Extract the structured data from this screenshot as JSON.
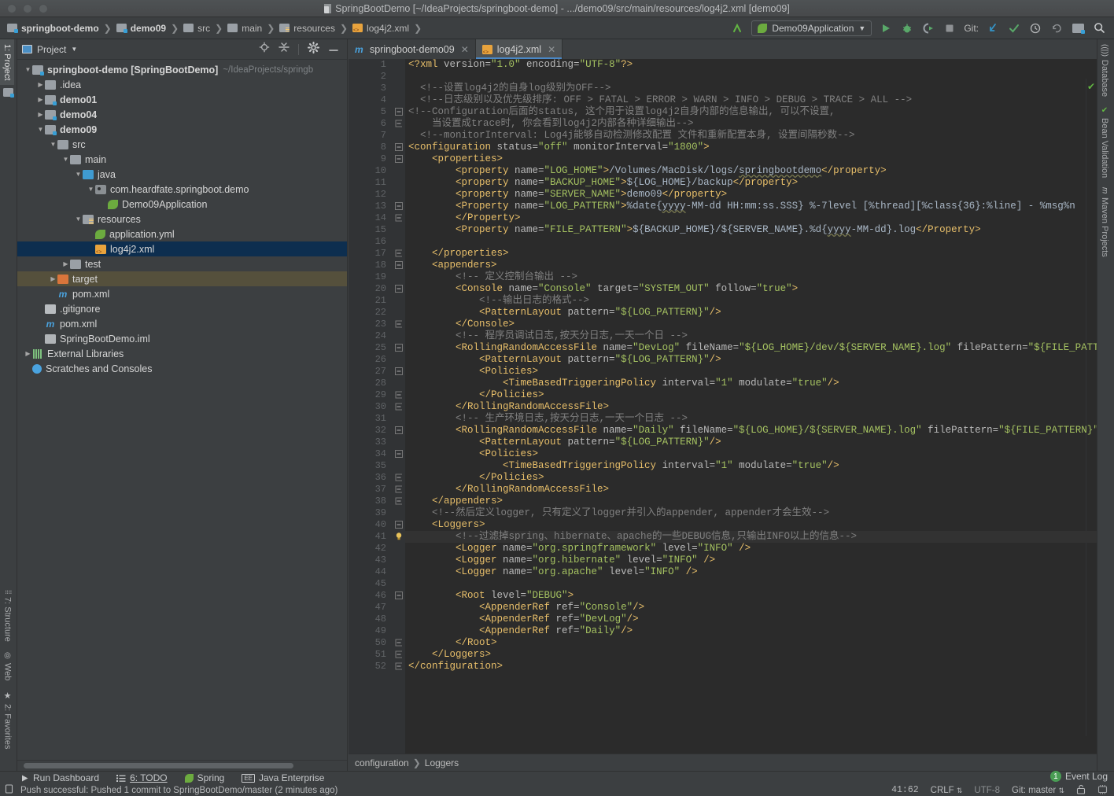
{
  "window": {
    "title": "SpringBootDemo [~/IdeaProjects/springboot-demo] - .../demo09/src/main/resources/log4j2.xml [demo09]"
  },
  "toolbar": {
    "breadcrumbs": [
      {
        "label": "springboot-demo",
        "icon": "module-folder-icon",
        "bold": true
      },
      {
        "label": "demo09",
        "icon": "module-folder-icon",
        "bold": true
      },
      {
        "label": "src",
        "icon": "folder-icon",
        "bold": false
      },
      {
        "label": "main",
        "icon": "folder-icon",
        "bold": false
      },
      {
        "label": "resources",
        "icon": "resources-folder-icon",
        "bold": false
      },
      {
        "label": "log4j2.xml",
        "icon": "xml-file-icon",
        "bold": false
      }
    ],
    "run_config": "Demo09Application",
    "git_label": "Git:"
  },
  "project_panel": {
    "title": "Project",
    "tree": [
      {
        "depth": 0,
        "arrow": "▼",
        "icon": "module-folder-icon",
        "name": "springboot-demo [SpringBootDemo]",
        "bold": true,
        "path": "~/IdeaProjects/springb",
        "state": "normal"
      },
      {
        "depth": 1,
        "arrow": "▶",
        "icon": "folder-icon",
        "name": ".idea",
        "bold": false,
        "path": "",
        "state": "normal"
      },
      {
        "depth": 1,
        "arrow": "▶",
        "icon": "module-folder-icon",
        "name": "demo01",
        "bold": true,
        "path": "",
        "state": "normal"
      },
      {
        "depth": 1,
        "arrow": "▶",
        "icon": "module-folder-icon",
        "name": "demo04",
        "bold": true,
        "path": "",
        "state": "normal"
      },
      {
        "depth": 1,
        "arrow": "▼",
        "icon": "module-folder-icon",
        "name": "demo09",
        "bold": true,
        "path": "",
        "state": "normal"
      },
      {
        "depth": 2,
        "arrow": "▼",
        "icon": "folder-icon",
        "name": "src",
        "bold": false,
        "path": "",
        "state": "normal"
      },
      {
        "depth": 3,
        "arrow": "▼",
        "icon": "folder-icon",
        "name": "main",
        "bold": false,
        "path": "",
        "state": "normal"
      },
      {
        "depth": 4,
        "arrow": "▼",
        "icon": "source-folder-icon",
        "name": "java",
        "bold": false,
        "path": "",
        "state": "normal"
      },
      {
        "depth": 5,
        "arrow": "▼",
        "icon": "package-icon",
        "name": "com.heardfate.springboot.demo",
        "bold": false,
        "path": "",
        "state": "normal"
      },
      {
        "depth": 6,
        "arrow": "",
        "icon": "spring-class-icon",
        "name": "Demo09Application",
        "bold": false,
        "path": "",
        "state": "normal"
      },
      {
        "depth": 4,
        "arrow": "▼",
        "icon": "resources-folder-icon",
        "name": "resources",
        "bold": false,
        "path": "",
        "state": "normal"
      },
      {
        "depth": 5,
        "arrow": "",
        "icon": "spring-yml-icon",
        "name": "application.yml",
        "bold": false,
        "path": "",
        "state": "normal"
      },
      {
        "depth": 5,
        "arrow": "",
        "icon": "xml-file-icon",
        "name": "log4j2.xml",
        "bold": false,
        "path": "",
        "state": "selected"
      },
      {
        "depth": 3,
        "arrow": "▶",
        "icon": "folder-icon",
        "name": "test",
        "bold": false,
        "path": "",
        "state": "normal"
      },
      {
        "depth": 2,
        "arrow": "▶",
        "icon": "excluded-folder-icon",
        "name": "target",
        "bold": false,
        "path": "",
        "state": "highlight"
      },
      {
        "depth": 2,
        "arrow": "",
        "icon": "maven-icon",
        "name": "pom.xml",
        "bold": false,
        "path": "",
        "state": "normal"
      },
      {
        "depth": 1,
        "arrow": "",
        "icon": "file-icon",
        "name": ".gitignore",
        "bold": false,
        "path": "",
        "state": "normal"
      },
      {
        "depth": 1,
        "arrow": "",
        "icon": "maven-icon",
        "name": "pom.xml",
        "bold": false,
        "path": "",
        "state": "normal"
      },
      {
        "depth": 1,
        "arrow": "",
        "icon": "iml-file-icon",
        "name": "SpringBootDemo.iml",
        "bold": false,
        "path": "",
        "state": "normal"
      },
      {
        "depth": 0,
        "arrow": "▶",
        "icon": "library-icon",
        "name": "External Libraries",
        "bold": false,
        "path": "",
        "state": "normal"
      },
      {
        "depth": 0,
        "arrow": "",
        "icon": "scratch-icon",
        "name": "Scratches and Consoles",
        "bold": false,
        "path": "",
        "state": "normal"
      }
    ]
  },
  "stripes": {
    "left_top": [
      "1: Project"
    ],
    "left_bottom": [
      "2: Favorites",
      "Web",
      "7: Structure"
    ],
    "right_top": [
      "Database",
      "Bean Validation",
      "Maven Projects"
    ]
  },
  "editor": {
    "tabs": [
      {
        "label": "springboot-demo09",
        "icon": "maven-icon",
        "active": false
      },
      {
        "label": "log4j2.xml",
        "icon": "xml-file-icon",
        "active": true
      }
    ],
    "current_line": 41,
    "breadcrumbs": [
      "configuration",
      "Loggers"
    ],
    "lines": [
      {
        "n": 1,
        "fold": "",
        "html": "<span class=\"pi\">&lt;?xml </span><span class=\"attr\">version=</span><span class=\"val\">\"1.0\"</span><span class=\"attr\"> encoding=</span><span class=\"val\">\"UTF-8\"</span><span class=\"pi\">?&gt;</span>"
      },
      {
        "n": 2,
        "fold": "",
        "html": ""
      },
      {
        "n": 3,
        "fold": "",
        "html": "  <span class=\"cmt\">&lt;!--设置log4j2的自身log级别为OFF--&gt;</span>"
      },
      {
        "n": 4,
        "fold": "",
        "html": "  <span class=\"cmt\">&lt;!--日志级别以及优先级排序: OFF &gt; FATAL &gt; ERROR &gt; WARN &gt; INFO &gt; DEBUG &gt; TRACE &gt; ALL --&gt;</span>"
      },
      {
        "n": 5,
        "fold": "-",
        "html": "<span class=\"cmt\">&lt;!--Configuration后面的status, 这个用于设置log4j2自身内部的信息输出, 可以不设置,</span>"
      },
      {
        "n": 6,
        "fold": "e",
        "html": "    <span class=\"cmt\">当设置成trace时, 你会看到log4j2内部各种详细输出--&gt;</span>"
      },
      {
        "n": 7,
        "fold": "",
        "html": "  <span class=\"cmt\">&lt;!--monitorInterval: Log4j能够自动检测修改配置 文件和重新配置本身, 设置间隔秒数--&gt;</span>"
      },
      {
        "n": 8,
        "fold": "-",
        "html": "<span class=\"tag\">&lt;configuration </span><span class=\"attr\">status=</span><span class=\"val\">\"off\"</span><span class=\"attr\"> monitorInterval=</span><span class=\"val\">\"1800\"</span><span class=\"tag\">&gt;</span>"
      },
      {
        "n": 9,
        "fold": "-",
        "html": "    <span class=\"tag\">&lt;properties&gt;</span>"
      },
      {
        "n": 10,
        "fold": "",
        "html": "        <span class=\"tag\">&lt;property </span><span class=\"attr\">name=</span><span class=\"val\">\"LOG_HOME\"</span><span class=\"tag\">&gt;</span><span class=\"txt\">/Volumes/MacDisk/logs/</span><span class=\"txt err-underline\">springbootdemo</span><span class=\"tag\">&lt;/property&gt;</span>"
      },
      {
        "n": 11,
        "fold": "",
        "html": "        <span class=\"tag\">&lt;property </span><span class=\"attr\">name=</span><span class=\"val\">\"BACKUP_HOME\"</span><span class=\"tag\">&gt;</span><span class=\"txt\">${LOG_HOME}/backup</span><span class=\"tag\">&lt;/property&gt;</span>"
      },
      {
        "n": 12,
        "fold": "",
        "html": "        <span class=\"tag\">&lt;property </span><span class=\"attr\">name=</span><span class=\"val\">\"SERVER_NAME\"</span><span class=\"tag\">&gt;</span><span class=\"txt\">demo09</span><span class=\"tag\">&lt;/property&gt;</span>"
      },
      {
        "n": 13,
        "fold": "-",
        "html": "        <span class=\"tag\">&lt;Property </span><span class=\"attr\">name=</span><span class=\"val\">\"LOG_PATTERN\"</span><span class=\"tag\">&gt;</span><span class=\"txt\">%date{</span><span class=\"txt err-underline\">yyyy</span><span class=\"txt\">-MM-dd HH:mm:ss.SSS} %-7level [%thread][%class{36}:%line] - %msg%n</span>"
      },
      {
        "n": 14,
        "fold": "e",
        "html": "        <span class=\"tag\">&lt;/Property&gt;</span>"
      },
      {
        "n": 15,
        "fold": "",
        "html": "        <span class=\"tag\">&lt;Property </span><span class=\"attr\">name=</span><span class=\"val\">\"FILE_PATTERN\"</span><span class=\"tag\">&gt;</span><span class=\"txt\">${BACKUP_HOME}/${SERVER_NAME}.%d{</span><span class=\"txt err-underline\">yyyy</span><span class=\"txt\">-MM-dd}.log</span><span class=\"tag\">&lt;/Property&gt;</span>"
      },
      {
        "n": 16,
        "fold": "",
        "html": ""
      },
      {
        "n": 17,
        "fold": "e",
        "html": "    <span class=\"tag\">&lt;/properties&gt;</span>"
      },
      {
        "n": 18,
        "fold": "-",
        "html": "    <span class=\"tag\">&lt;appenders&gt;</span>"
      },
      {
        "n": 19,
        "fold": "",
        "html": "        <span class=\"cmt\">&lt;!-- 定义控制台输出 --&gt;</span>"
      },
      {
        "n": 20,
        "fold": "-",
        "html": "        <span class=\"tag\">&lt;Console </span><span class=\"attr\">name=</span><span class=\"val\">\"Console\"</span><span class=\"attr\"> target=</span><span class=\"val\">\"SYSTEM_OUT\"</span><span class=\"attr\"> follow=</span><span class=\"val\">\"true\"</span><span class=\"tag\">&gt;</span>"
      },
      {
        "n": 21,
        "fold": "",
        "html": "            <span class=\"cmt\">&lt;!--输出日志的格式--&gt;</span>"
      },
      {
        "n": 22,
        "fold": "",
        "html": "            <span class=\"tag\">&lt;PatternLayout </span><span class=\"attr\">pattern=</span><span class=\"val\">\"${LOG_PATTERN}\"</span><span class=\"tag\">/&gt;</span>"
      },
      {
        "n": 23,
        "fold": "e",
        "html": "        <span class=\"tag\">&lt;/Console&gt;</span>"
      },
      {
        "n": 24,
        "fold": "",
        "html": "        <span class=\"cmt\">&lt;!-- 程序员调试日志,按天分日志,一天一个日 --&gt;</span>"
      },
      {
        "n": 25,
        "fold": "-",
        "html": "        <span class=\"tag\">&lt;RollingRandomAccessFile </span><span class=\"attr\">name=</span><span class=\"val\">\"DevLog\"</span><span class=\"attr\"> fileName=</span><span class=\"val\">\"${LOG_HOME}/dev/${SERVER_NAME}.log\"</span><span class=\"attr\"> filePattern=</span><span class=\"val\">\"${FILE_PATTERN}\"</span><span class=\"tag\">&gt;</span>"
      },
      {
        "n": 26,
        "fold": "",
        "html": "            <span class=\"tag\">&lt;PatternLayout </span><span class=\"attr\">pattern=</span><span class=\"val\">\"${LOG_PATTERN}\"</span><span class=\"tag\">/&gt;</span>"
      },
      {
        "n": 27,
        "fold": "-",
        "html": "            <span class=\"tag\">&lt;Policies&gt;</span>"
      },
      {
        "n": 28,
        "fold": "",
        "html": "                <span class=\"tag\">&lt;TimeBasedTriggeringPolicy </span><span class=\"attr\">interval=</span><span class=\"val\">\"1\"</span><span class=\"attr\"> modulate=</span><span class=\"val\">\"true\"</span><span class=\"tag\">/&gt;</span>"
      },
      {
        "n": 29,
        "fold": "e",
        "html": "            <span class=\"tag\">&lt;/Policies&gt;</span>"
      },
      {
        "n": 30,
        "fold": "e",
        "html": "        <span class=\"tag\">&lt;/RollingRandomAccessFile&gt;</span>"
      },
      {
        "n": 31,
        "fold": "",
        "html": "        <span class=\"cmt\">&lt;!-- 生产环境日志,按天分日志,一天一个日志 --&gt;</span>"
      },
      {
        "n": 32,
        "fold": "-",
        "html": "        <span class=\"tag\">&lt;RollingRandomAccessFile </span><span class=\"attr\">name=</span><span class=\"val\">\"Daily\"</span><span class=\"attr\"> fileName=</span><span class=\"val\">\"${LOG_HOME}/${SERVER_NAME}.log\"</span><span class=\"attr\"> filePattern=</span><span class=\"val\">\"${FILE_PATTERN}\"</span><span class=\"tag\">&gt;</span>"
      },
      {
        "n": 33,
        "fold": "",
        "html": "            <span class=\"tag\">&lt;PatternLayout </span><span class=\"attr\">pattern=</span><span class=\"val\">\"${LOG_PATTERN}\"</span><span class=\"tag\">/&gt;</span>"
      },
      {
        "n": 34,
        "fold": "-",
        "html": "            <span class=\"tag\">&lt;Policies&gt;</span>"
      },
      {
        "n": 35,
        "fold": "",
        "html": "                <span class=\"tag\">&lt;TimeBasedTriggeringPolicy </span><span class=\"attr\">interval=</span><span class=\"val\">\"1\"</span><span class=\"attr\"> modulate=</span><span class=\"val\">\"true\"</span><span class=\"tag\">/&gt;</span>"
      },
      {
        "n": 36,
        "fold": "e",
        "html": "            <span class=\"tag\">&lt;/Policies&gt;</span>"
      },
      {
        "n": 37,
        "fold": "e",
        "html": "        <span class=\"tag\">&lt;/RollingRandomAccessFile&gt;</span>"
      },
      {
        "n": 38,
        "fold": "e",
        "html": "    <span class=\"tag\">&lt;/appenders&gt;</span>"
      },
      {
        "n": 39,
        "fold": "",
        "html": "    <span class=\"cmt\">&lt;!--然后定义logger, 只有定义了logger并引入的appender, appender才会生效--&gt;</span>"
      },
      {
        "n": 40,
        "fold": "-",
        "html": "    <span class=\"tag\">&lt;Loggers&gt;</span>"
      },
      {
        "n": 41,
        "fold": "",
        "html": "        <span class=\"cmt\">&lt;!--过滤掉spring、hibernate、apache的一些DEBUG信息,只输出INFO以上的信息--&gt;</span>"
      },
      {
        "n": 42,
        "fold": "",
        "html": "        <span class=\"tag\">&lt;Logger </span><span class=\"attr\">name=</span><span class=\"val\">\"org.springframework\"</span><span class=\"attr\"> level=</span><span class=\"val\">\"INFO\"</span><span class=\"tag\"> /&gt;</span>"
      },
      {
        "n": 43,
        "fold": "",
        "html": "        <span class=\"tag\">&lt;Logger </span><span class=\"attr\">name=</span><span class=\"val\">\"org.hibernate\"</span><span class=\"attr\"> level=</span><span class=\"val\">\"INFO\"</span><span class=\"tag\"> /&gt;</span>"
      },
      {
        "n": 44,
        "fold": "",
        "html": "        <span class=\"tag\">&lt;Logger </span><span class=\"attr\">name=</span><span class=\"val\">\"org.apache\"</span><span class=\"attr\"> level=</span><span class=\"val\">\"INFO\"</span><span class=\"tag\"> /&gt;</span>"
      },
      {
        "n": 45,
        "fold": "",
        "html": ""
      },
      {
        "n": 46,
        "fold": "-",
        "html": "        <span class=\"tag\">&lt;Root </span><span class=\"attr\">level=</span><span class=\"val\">\"DEBUG\"</span><span class=\"tag\">&gt;</span>"
      },
      {
        "n": 47,
        "fold": "",
        "html": "            <span class=\"tag\">&lt;AppenderRef </span><span class=\"attr\">ref=</span><span class=\"val\">\"Console\"</span><span class=\"tag\">/&gt;</span>"
      },
      {
        "n": 48,
        "fold": "",
        "html": "            <span class=\"tag\">&lt;AppenderRef </span><span class=\"attr\">ref=</span><span class=\"val\">\"DevLog\"</span><span class=\"tag\">/&gt;</span>"
      },
      {
        "n": 49,
        "fold": "",
        "html": "            <span class=\"tag\">&lt;AppenderRef </span><span class=\"attr\">ref=</span><span class=\"val\">\"Daily\"</span><span class=\"tag\">/&gt;</span>"
      },
      {
        "n": 50,
        "fold": "e",
        "html": "        <span class=\"tag\">&lt;/Root&gt;</span>"
      },
      {
        "n": 51,
        "fold": "e",
        "html": "    <span class=\"tag\">&lt;/Loggers&gt;</span>"
      },
      {
        "n": 52,
        "fold": "e",
        "html": "<span class=\"tag\">&lt;/configuration&gt;</span>"
      }
    ]
  },
  "status": {
    "tool_buttons": [
      {
        "label": "Run Dashboard",
        "icon": "play-icon"
      },
      {
        "label": "6: TODO",
        "icon": "todo-list-icon"
      },
      {
        "label": "Spring",
        "icon": "spring-leaf-icon"
      },
      {
        "label": "Java Enterprise",
        "icon": "java-ee-icon"
      }
    ],
    "message": "Push successful: Pushed 1 commit to SpringBootDemo/master (2 minutes ago)",
    "event_log": "Event Log",
    "event_count": "1",
    "caret_position": "41:62",
    "line_separator": "CRLF",
    "encoding": "UTF-8",
    "git_branch": "Git: master"
  },
  "colors": {
    "accent": "#4a88c7",
    "selection": "#0d2e4f",
    "editor_bg": "#2b2b2b",
    "panel_bg": "#3c3f41",
    "tag": "#e8bf6a",
    "value": "#a5c261",
    "comment": "#808080"
  }
}
